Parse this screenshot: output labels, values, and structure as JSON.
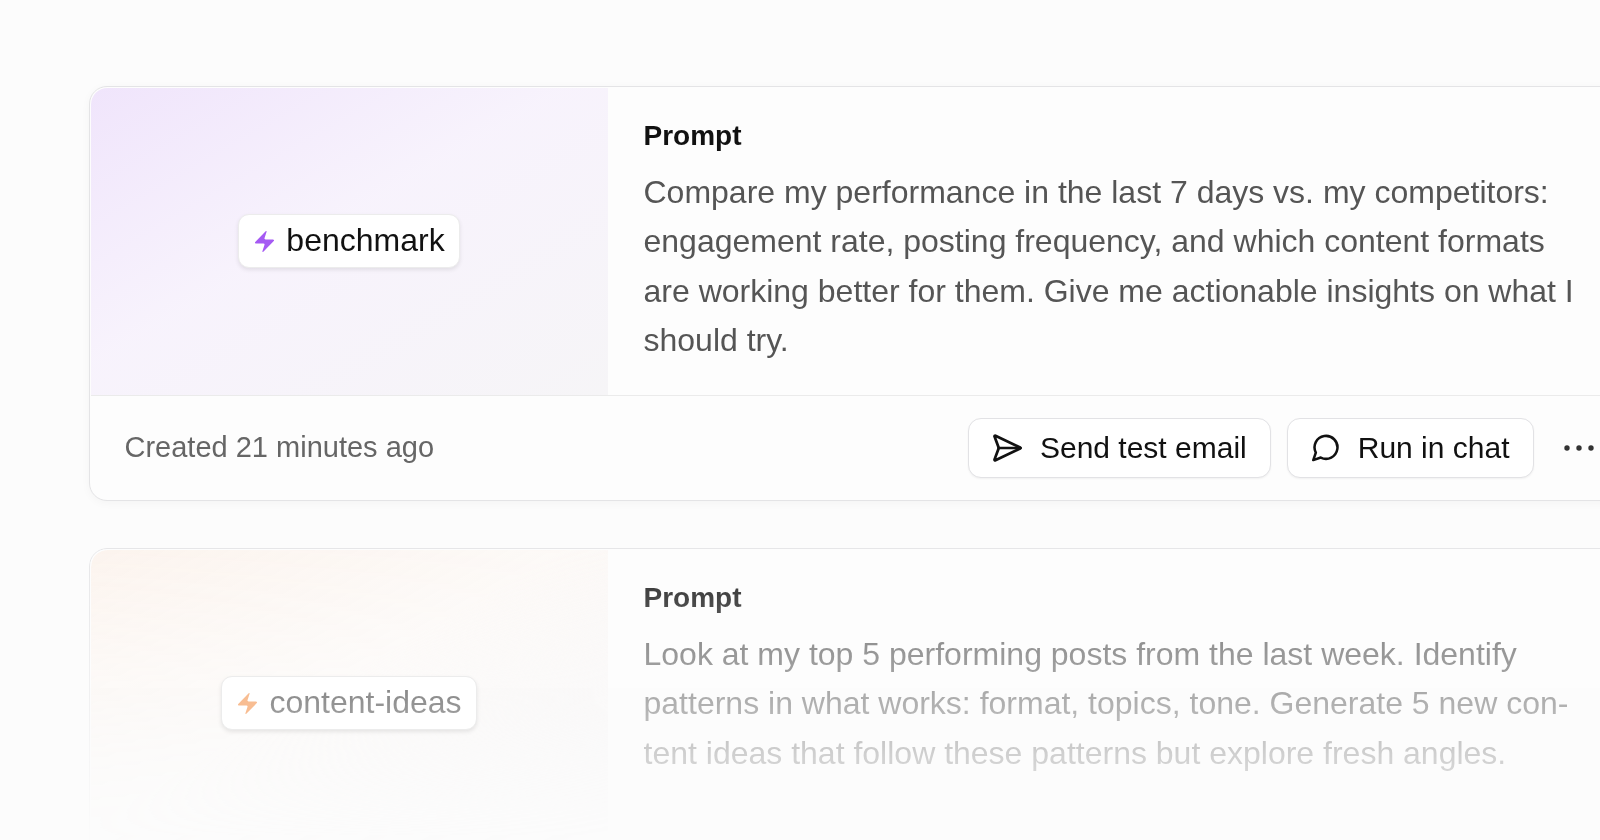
{
  "cards": [
    {
      "tag": {
        "label": "benchmark",
        "color": "#a55af3"
      },
      "prompt": {
        "title": "Prompt",
        "text": "Compare my performance in the last 7 days vs. my competitors: engagement rate, posting frequency, and which content formats are working better for them. Give me actionable insights on what I should try."
      },
      "footer": {
        "created": "Created 21 minutes ago",
        "actions": [
          {
            "kind": "send",
            "label": "Send test email"
          },
          {
            "kind": "chat",
            "label": "Run in chat"
          },
          {
            "kind": "more"
          }
        ]
      }
    },
    {
      "tag": {
        "label": "content-ideas",
        "color": "#f8bd92"
      },
      "prompt": {
        "title": "Prompt",
        "text": "Look at my top 5 performing posts from the last week. Identify patterns in what works: format, topics, tone. Generate 5 new con-tent ideas that follow these patterns but explore fresh angles."
      }
    }
  ]
}
